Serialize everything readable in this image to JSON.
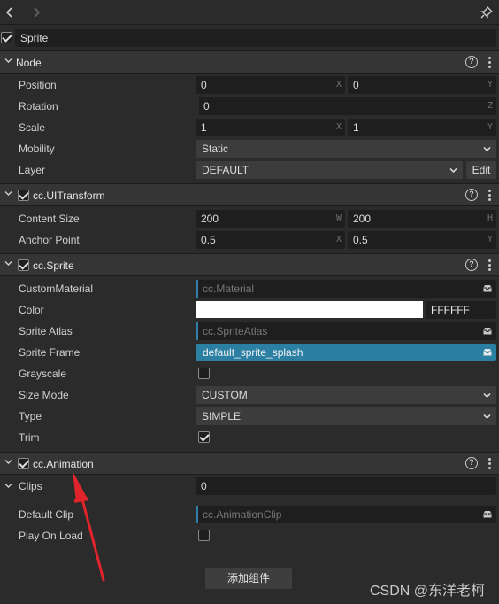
{
  "node_name": "Sprite",
  "sections": {
    "node": {
      "title": "Node",
      "position": {
        "label": "Position",
        "x": "0",
        "y": "0",
        "x_axis": "X",
        "y_axis": "Y"
      },
      "rotation": {
        "label": "Rotation",
        "value": "0",
        "axis": "Z"
      },
      "scale": {
        "label": "Scale",
        "x": "1",
        "y": "1",
        "x_axis": "X",
        "y_axis": "Y"
      },
      "mobility": {
        "label": "Mobility",
        "value": "Static"
      },
      "layer": {
        "label": "Layer",
        "value": "DEFAULT",
        "edit_label": "Edit"
      }
    },
    "ui_transform": {
      "title": "cc.UITransform",
      "content_size": {
        "label": "Content Size",
        "w": "200",
        "h": "200",
        "w_axis": "W",
        "h_axis": "H"
      },
      "anchor_point": {
        "label": "Anchor Point",
        "x": "0.5",
        "y": "0.5",
        "x_axis": "X",
        "y_axis": "Y"
      }
    },
    "sprite": {
      "title": "cc.Sprite",
      "custom_material": {
        "label": "CustomMaterial",
        "value": "cc.Material"
      },
      "color": {
        "label": "Color",
        "hex": "FFFFFF",
        "swatch": "#ffffff"
      },
      "sprite_atlas": {
        "label": "Sprite Atlas",
        "value": "cc.SpriteAtlas"
      },
      "sprite_frame": {
        "label": "Sprite Frame",
        "value": "default_sprite_splash"
      },
      "grayscale": {
        "label": "Grayscale",
        "checked": false
      },
      "size_mode": {
        "label": "Size Mode",
        "value": "CUSTOM"
      },
      "type": {
        "label": "Type",
        "value": "SIMPLE"
      },
      "trim": {
        "label": "Trim",
        "checked": true
      }
    },
    "animation": {
      "title": "cc.Animation",
      "clips": {
        "label": "Clips",
        "value": "0"
      },
      "default_clip": {
        "label": "Default Clip",
        "value": "cc.AnimationClip"
      },
      "play_on_load": {
        "label": "Play On Load",
        "checked": false
      }
    }
  },
  "add_component_label": "添加组件",
  "watermark": "CSDN @东洋老柯",
  "colors": {
    "accent": "#2f7fa8",
    "annotation_arrow": "#e0242b",
    "panel": "#2b2b2b"
  }
}
